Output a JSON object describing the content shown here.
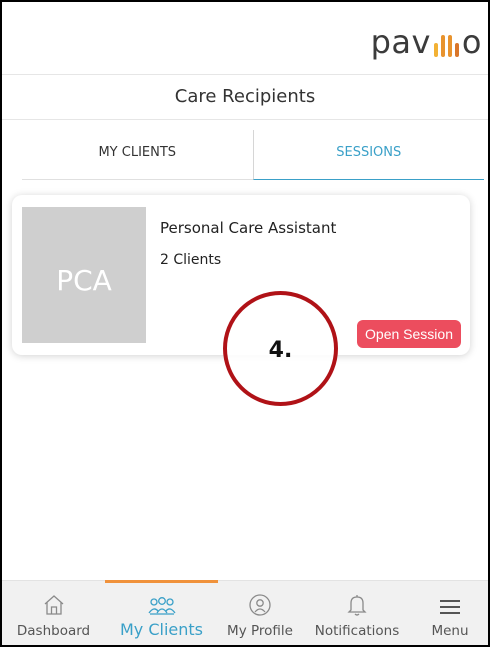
{
  "app": {
    "logo_left": "pav",
    "logo_right": "o",
    "logo_bar_colors": [
      "#f2b134",
      "#e8932e",
      "#d9762a"
    ]
  },
  "header": {
    "title": "Care Recipients"
  },
  "tabs": [
    {
      "label": "MY CLIENTS",
      "active": false
    },
    {
      "label": "SESSIONS",
      "active": true
    }
  ],
  "card": {
    "avatar_text": "PCA",
    "title": "Personal Care Assistant",
    "subtitle": "2 Clients",
    "button_label": "Open Session"
  },
  "annotation": {
    "label": "4."
  },
  "bottom_nav": [
    {
      "label": "Dashboard",
      "icon": "home-icon",
      "active": false
    },
    {
      "label": "My Clients",
      "icon": "clients-icon",
      "active": true
    },
    {
      "label": "My Profile",
      "icon": "profile-icon",
      "active": false
    },
    {
      "label": "Notifications",
      "icon": "bell-icon",
      "active": false
    },
    {
      "label": "Menu",
      "icon": "menu-icon",
      "active": false
    }
  ],
  "colors": {
    "accent": "#3aa0c8",
    "nav_indicator": "#f0923b",
    "button": "#ec4d5e",
    "annotation_ring": "#b01217",
    "avatar_bg": "#cfcfcf"
  }
}
